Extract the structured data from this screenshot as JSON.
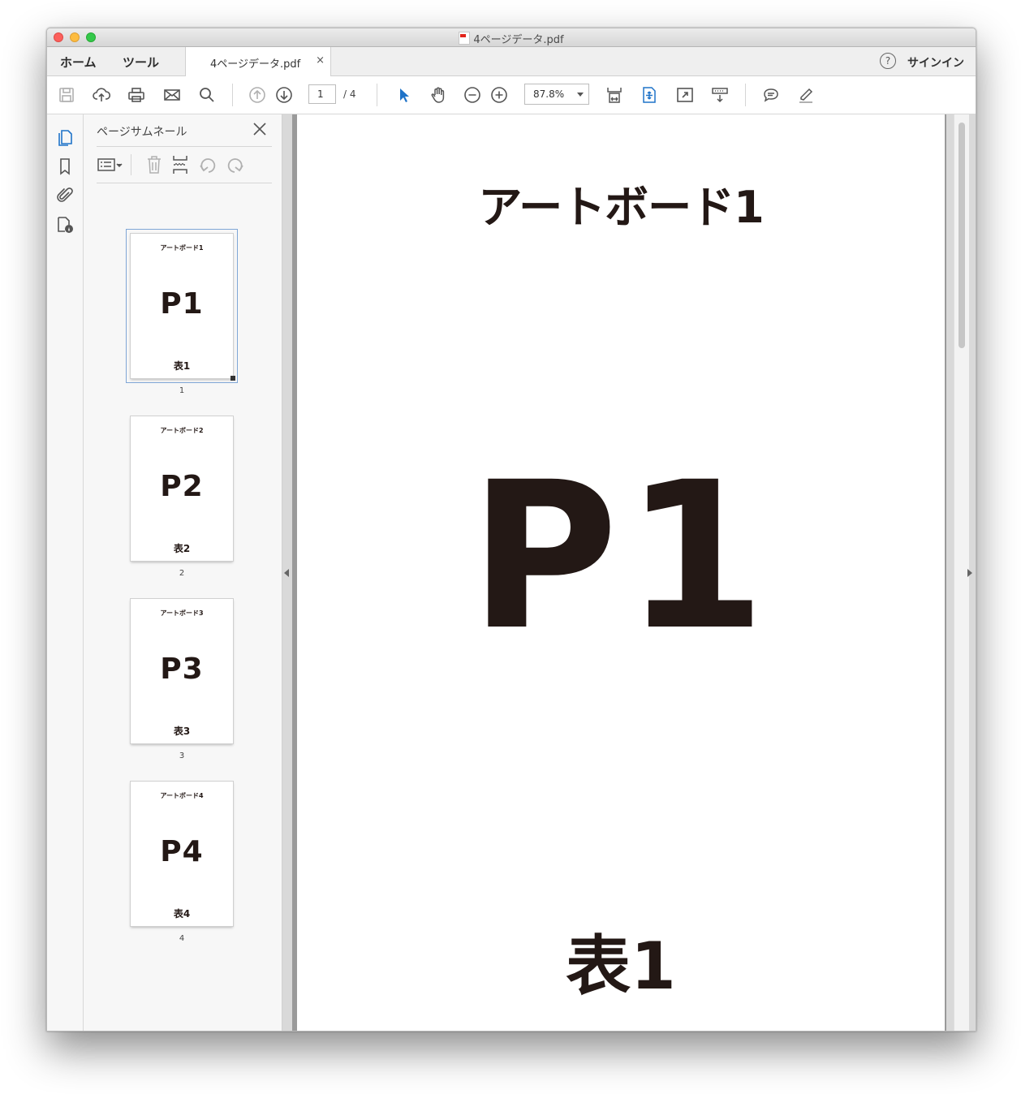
{
  "window": {
    "title": "4ページデータ.pdf"
  },
  "tabs": {
    "home": "ホーム",
    "tools": "ツール",
    "document": "4ページデータ.pdf",
    "close": "×"
  },
  "header": {
    "help": "?",
    "signin": "サインイン"
  },
  "toolbar": {
    "page_current": "1",
    "page_total": "/ 4",
    "zoom": "87.8%"
  },
  "panel": {
    "title": "ページサムネール",
    "thumbnails": [
      {
        "top": "アートボード1",
        "big": "P1",
        "bottom": "表1",
        "num": "1"
      },
      {
        "top": "アートボード2",
        "big": "P2",
        "bottom": "表2",
        "num": "2"
      },
      {
        "top": "アートボード3",
        "big": "P3",
        "bottom": "表3",
        "num": "3"
      },
      {
        "top": "アートボード4",
        "big": "P4",
        "bottom": "表4",
        "num": "4"
      }
    ]
  },
  "document": {
    "top": "アートボード1",
    "big": "P1",
    "bottom": "表1"
  },
  "colors": {
    "accent": "#1f73c8",
    "text": "#231815"
  }
}
